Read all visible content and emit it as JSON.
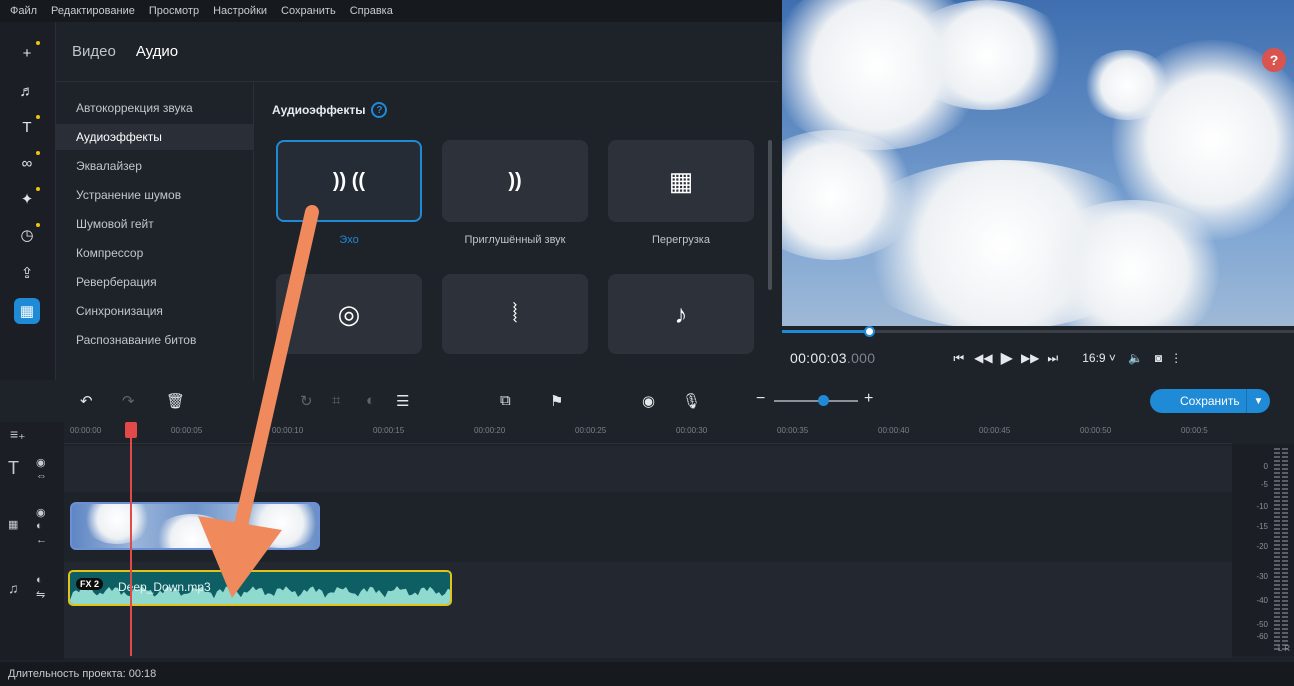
{
  "menu": [
    "Файл",
    "Редактирование",
    "Просмотр",
    "Настройки",
    "Сохранить",
    "Справка"
  ],
  "tabs": {
    "video": "Видео",
    "audio": "Аудио"
  },
  "categories": [
    "Автокоррекция звука",
    "Аудиоэффекты",
    "Эквалайзер",
    "Устранение шумов",
    "Шумовой гейт",
    "Компрессор",
    "Реверберация",
    "Синхронизация",
    "Распознавание битов"
  ],
  "panel": {
    "title": "Аудиоэффекты",
    "help": "?"
  },
  "effects": [
    {
      "label": "Эхо",
      "icon": "echo-icon",
      "glyph": "))) (((",
      "selected": true
    },
    {
      "label": "Приглушённый звук",
      "icon": "muffled-sound-icon",
      "glyph": ")))"
    },
    {
      "label": "Перегрузка",
      "icon": "overdrive-icon",
      "glyph": "▦"
    },
    {
      "label": "",
      "icon": "spiral-icon",
      "glyph": "◎"
    },
    {
      "label": "",
      "icon": "vibration-icon",
      "glyph": "⦚"
    },
    {
      "label": "",
      "icon": "notes-icon",
      "glyph": "♪"
    }
  ],
  "player": {
    "time": "00:00:03",
    "ms": ".000",
    "aspect": "16:9 ˅",
    "progress": 0.17
  },
  "help_badge": "?",
  "save": {
    "label": "Сохранить"
  },
  "ruler": [
    "00:00:00",
    "00:00:05",
    "00:00:10",
    "00:00:15",
    "00:00:20",
    "00:00:25",
    "00:00:30",
    "00:00:35",
    "00:00:40",
    "00:00:45",
    "00:00:50",
    "00:00:5"
  ],
  "audio_clip": {
    "name": "Deep_Down.mp3",
    "badge": "FX 2"
  },
  "meter_labels": [
    "0",
    "-5",
    "-10",
    "-15",
    "-20",
    "-30",
    "-40",
    "-50",
    "-60",
    "L R"
  ],
  "status": "Длительность проекта: 00:18",
  "colors": {
    "accent": "#1f8ad6",
    "playhead": "#e24a4a",
    "audio_border": "#e0c419",
    "arrow": "#f08a5d"
  }
}
